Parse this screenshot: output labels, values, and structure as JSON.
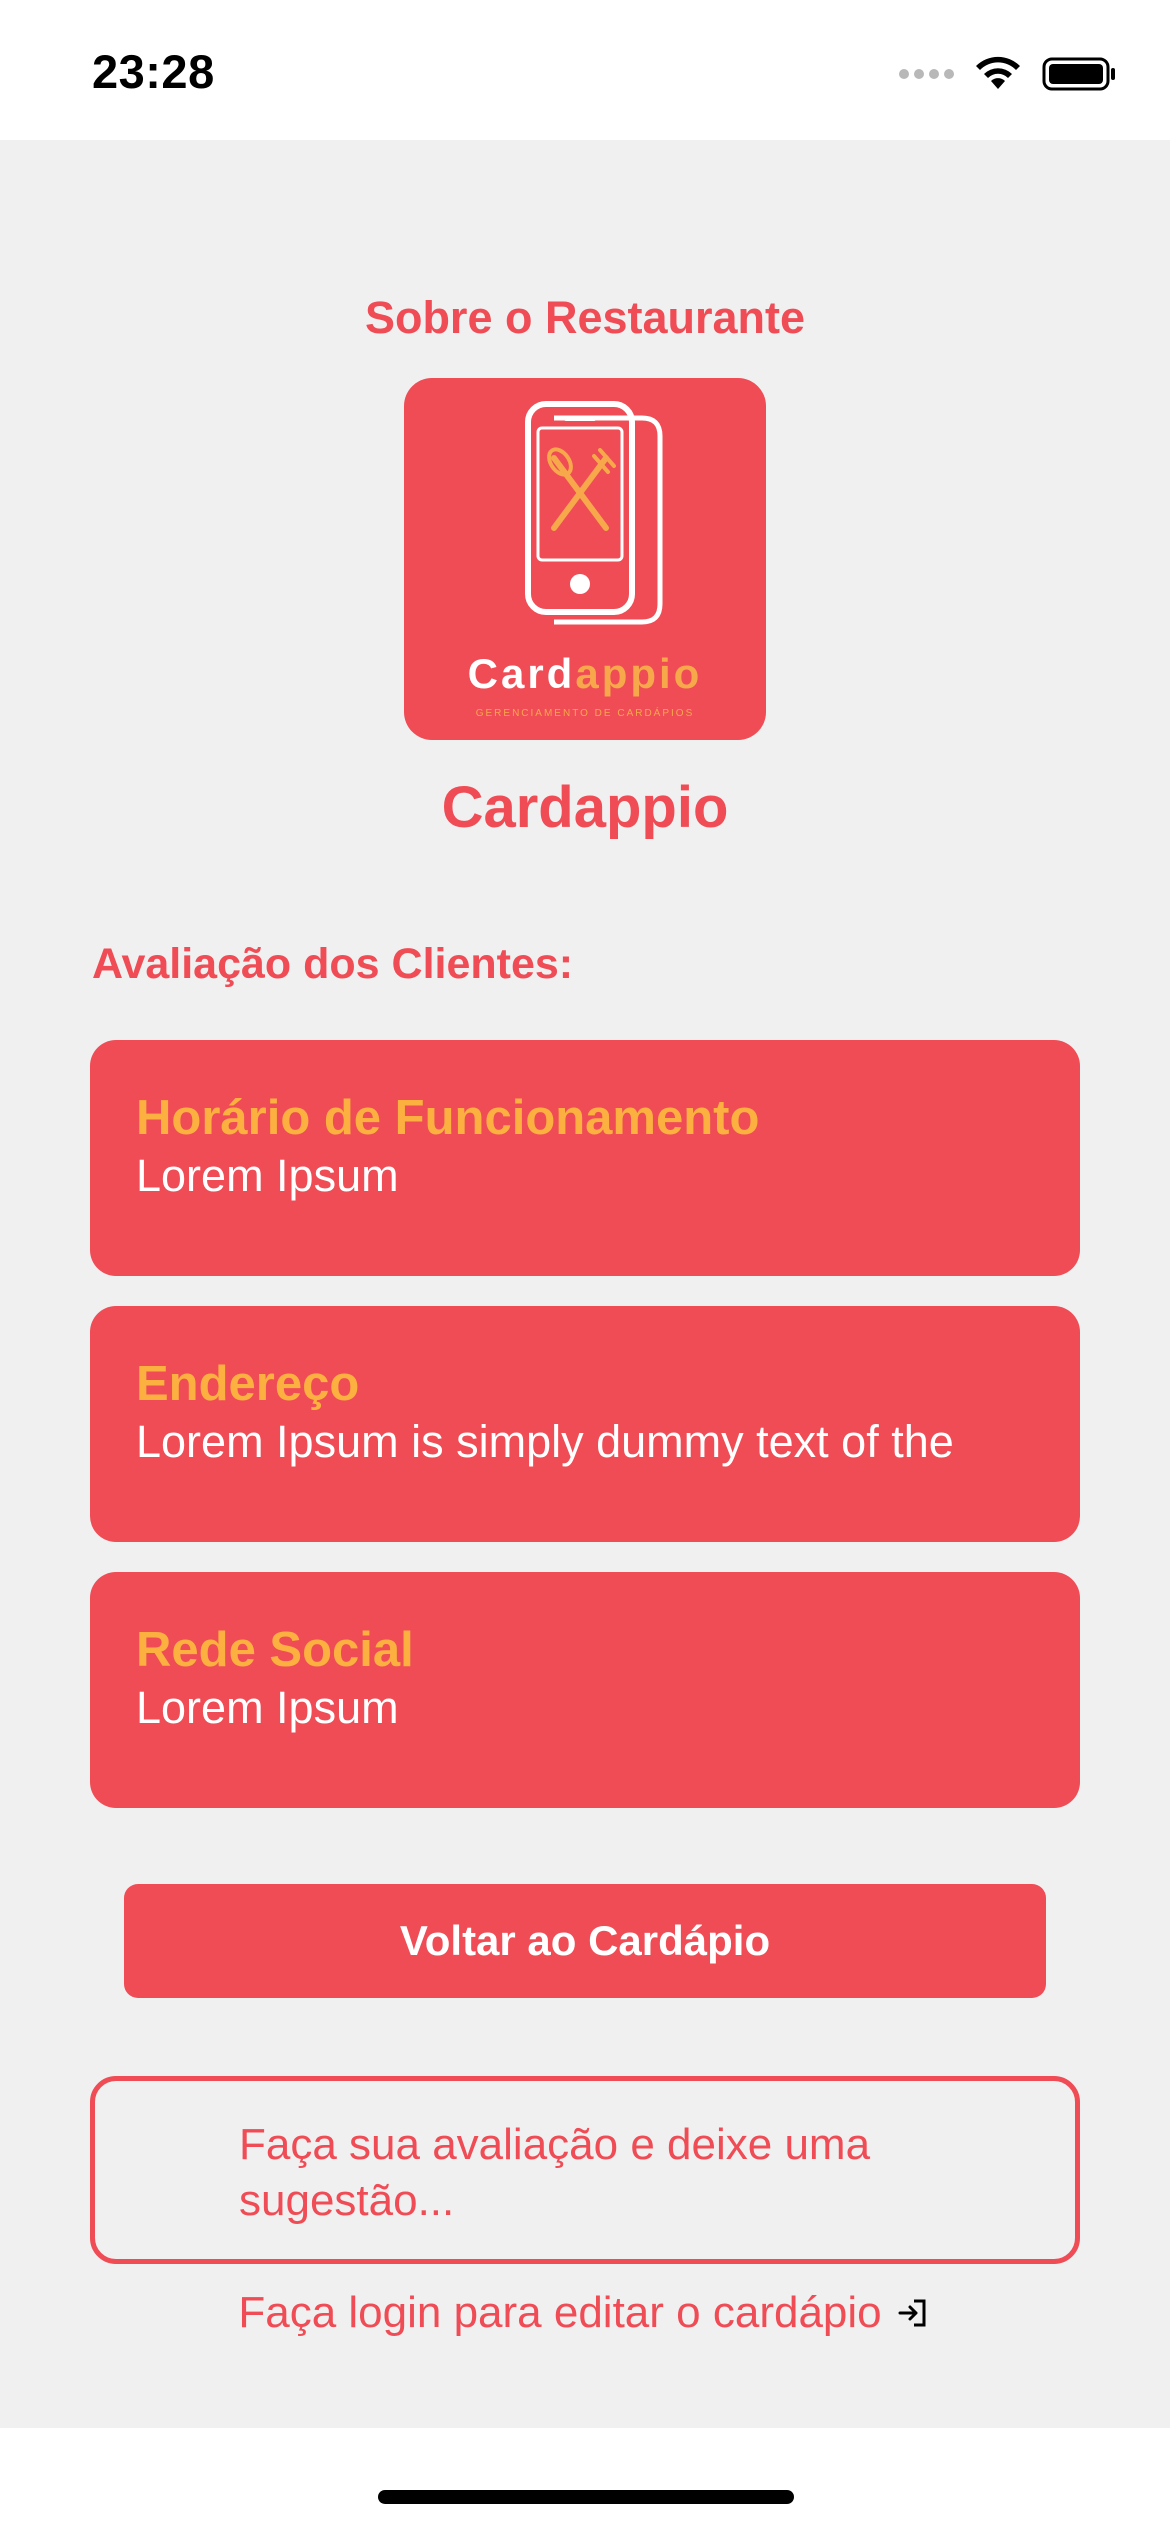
{
  "status_bar": {
    "time": "23:28"
  },
  "header": {
    "title": "Sobre o Restaurante"
  },
  "logo": {
    "word_main": "Card",
    "word_accent": "appio",
    "subtitle": "GERENCIAMENTO DE CARDÁPIOS"
  },
  "restaurant": {
    "name": "Cardappio"
  },
  "reviews": {
    "label": "Avaliação dos Clientes:"
  },
  "cards": [
    {
      "title": "Horário de Funcionamento",
      "text": "Lorem Ipsum"
    },
    {
      "title": "Endereço",
      "text": "Lorem Ipsum is simply dummy text of the"
    },
    {
      "title": "Rede Social",
      "text": "Lorem Ipsum"
    }
  ],
  "back_button": {
    "label": "Voltar ao Cardápio"
  },
  "feedback": {
    "placeholder": "Faça sua avaliação e deixe uma sugestão..."
  },
  "login": {
    "label": "Faça login para editar o cardápio"
  },
  "colors": {
    "primary": "#ef4c55",
    "accent": "#fbb040",
    "background": "#f0f0f0"
  }
}
